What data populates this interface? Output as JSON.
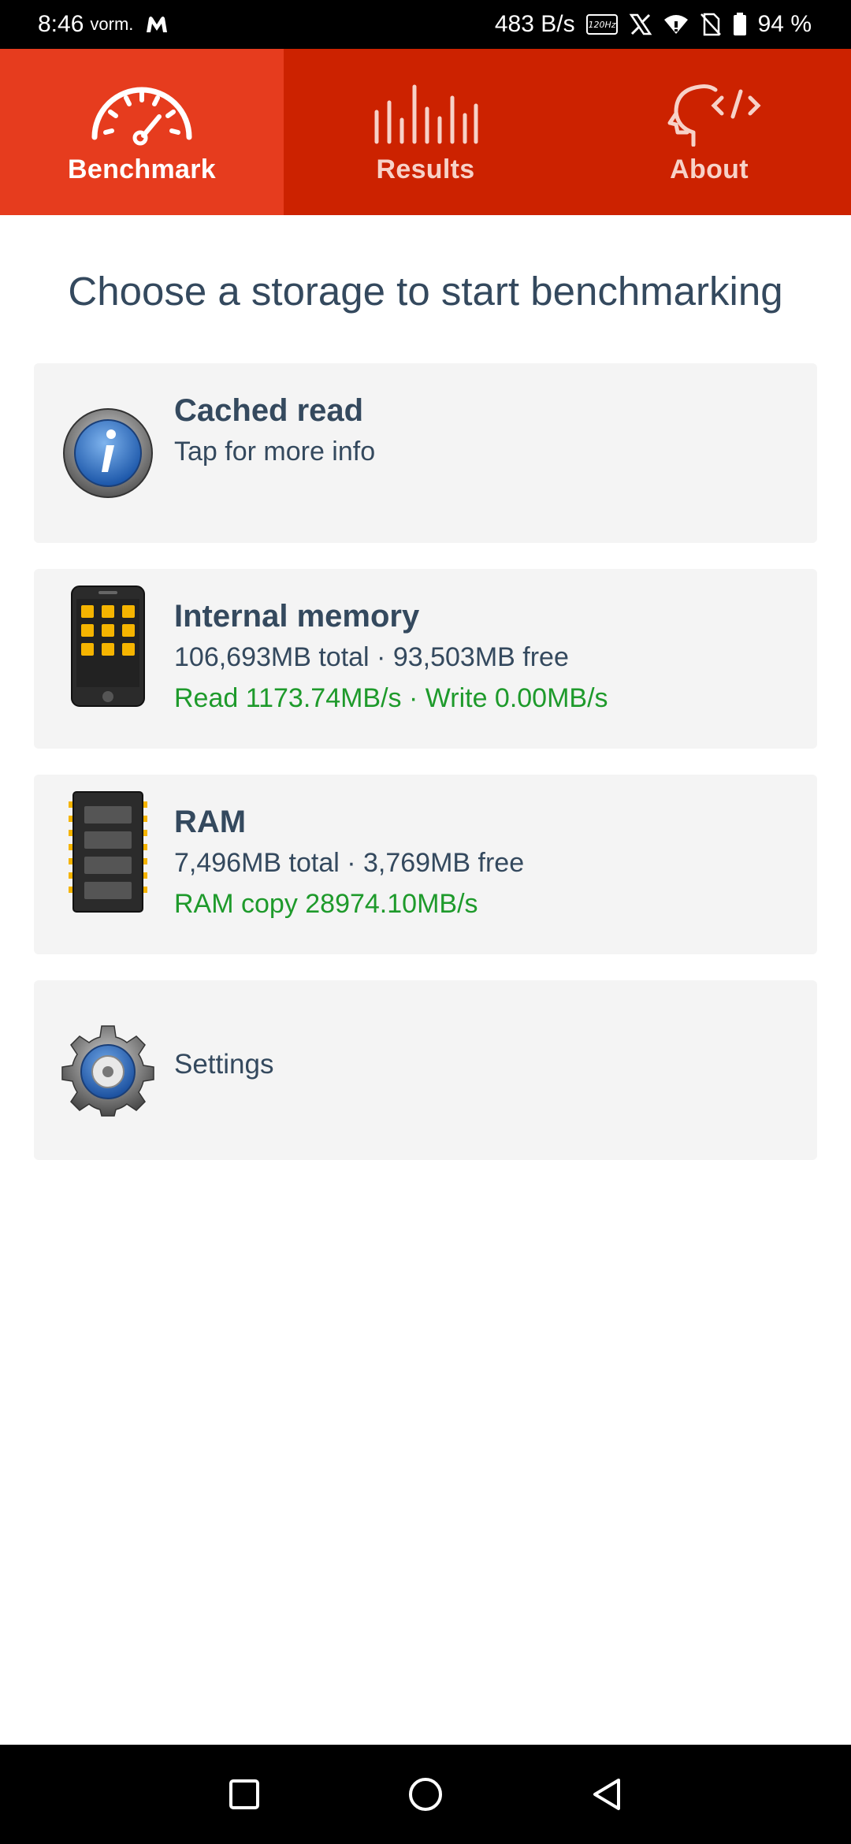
{
  "status_bar": {
    "time": "8:46",
    "time_suffix": "vorm.",
    "net_speed": "483 B/s",
    "refresh_rate": "120Hz",
    "battery": "94 %"
  },
  "tabs": [
    {
      "label": "Benchmark",
      "icon": "speedometer-icon",
      "active": true
    },
    {
      "label": "Results",
      "icon": "bars-icon",
      "active": false
    },
    {
      "label": "About",
      "icon": "head-code-icon",
      "active": false
    }
  ],
  "heading": "Choose a storage to start benchmarking",
  "cards": {
    "cached_read": {
      "title": "Cached read",
      "subtitle": "Tap for more info",
      "icon": "info-icon"
    },
    "internal_memory": {
      "title": "Internal memory",
      "capacity": "106,693MB total · 93,503MB free",
      "result": "Read 1173.74MB/s · Write 0.00MB/s",
      "icon": "phone-icon"
    },
    "ram": {
      "title": "RAM",
      "capacity": "7,496MB total · 3,769MB free",
      "result": "RAM copy 28974.10MB/s",
      "icon": "ram-chip-icon"
    },
    "settings": {
      "label": "Settings",
      "icon": "gear-icon"
    }
  },
  "colors": {
    "tab_bar": "#cc2200",
    "tab_active": "#e63c1e",
    "text_primary": "#34495e",
    "result_green": "#1e9a2b",
    "card_bg": "#f4f4f4"
  }
}
